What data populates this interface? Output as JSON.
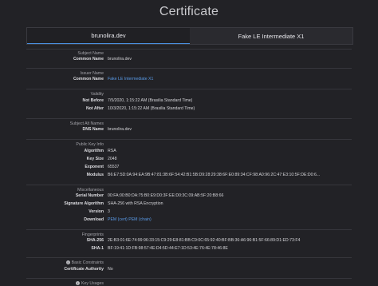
{
  "title": "Certificate",
  "tabs": [
    {
      "label": "brunolira.dev"
    },
    {
      "label": "Fake LE Intermediate X1"
    }
  ],
  "sections": {
    "subject": {
      "title": "Subject Name",
      "common_name_label": "Common Name",
      "common_name_value": "brunolira.dev"
    },
    "issuer": {
      "title": "Issuer Name",
      "common_name_label": "Common Name",
      "common_name_value": "Fake LE Intermediate X1"
    },
    "validity": {
      "title": "Validity",
      "not_before_label": "Not Before",
      "not_before_value": "7/5/2020, 1:15:22 AM (Brasilia Standard Time)",
      "not_after_label": "Not After",
      "not_after_value": "10/3/2020, 1:15:22 AM (Brasilia Standard Time)"
    },
    "san": {
      "title": "Subject Alt Names",
      "dns_label": "DNS Name",
      "dns_value": "brunolira.dev"
    },
    "pubkey": {
      "title": "Public Key Info",
      "algorithm_label": "Algorithm",
      "algorithm_value": "RSA",
      "keysize_label": "Key Size",
      "keysize_value": "2048",
      "exponent_label": "Exponent",
      "exponent_value": "65537",
      "modulus_label": "Modulus",
      "modulus_value": "B6:E7:5D:0A:94:EA:9B:47:81:3B:6F:54:42:B1:5B:D9:28:29:38:6F:E0:89:34:CF:98:A0:96:2C:47:E3:10:5F:DE:D0:6..."
    },
    "misc": {
      "title": "Miscellaneous",
      "serial_label": "Serial Number",
      "serial_value": "00:FA:00:B0:DA:75:B0:E9:D0:3F:EE:D0:3C:09:AB:5F:20:B8:66",
      "sigalg_label": "Signature Algorithm",
      "sigalg_value": "SHA-256 with RSA Encryption",
      "version_label": "Version",
      "version_value": "3",
      "download_label": "Download",
      "download_pem_cert": "PEM (cert)",
      "download_pem_chain": "PEM (chain)"
    },
    "fingerprints": {
      "title": "Fingerprints",
      "sha256_label": "SHA-256",
      "sha256_value": "2E:B3:01:6E:74:99:96:33:15:C9:29:E8:81:BB:C9:0C:65:92:40:BF:BB:36:A6:96:B1:5F:66:89:D1:ED:73:F4",
      "sha1_label": "SHA-1",
      "sha1_value": "BF:19:41:1D:FB:98:57:4E:D4:5D:44:E7:1D:53:4E:76:4E:78:46:8E"
    },
    "constraints": {
      "title": "Basic Constraints",
      "ca_label": "Certificate Authority",
      "ca_value": "No"
    },
    "keyusages": {
      "title": "Key Usages"
    }
  }
}
